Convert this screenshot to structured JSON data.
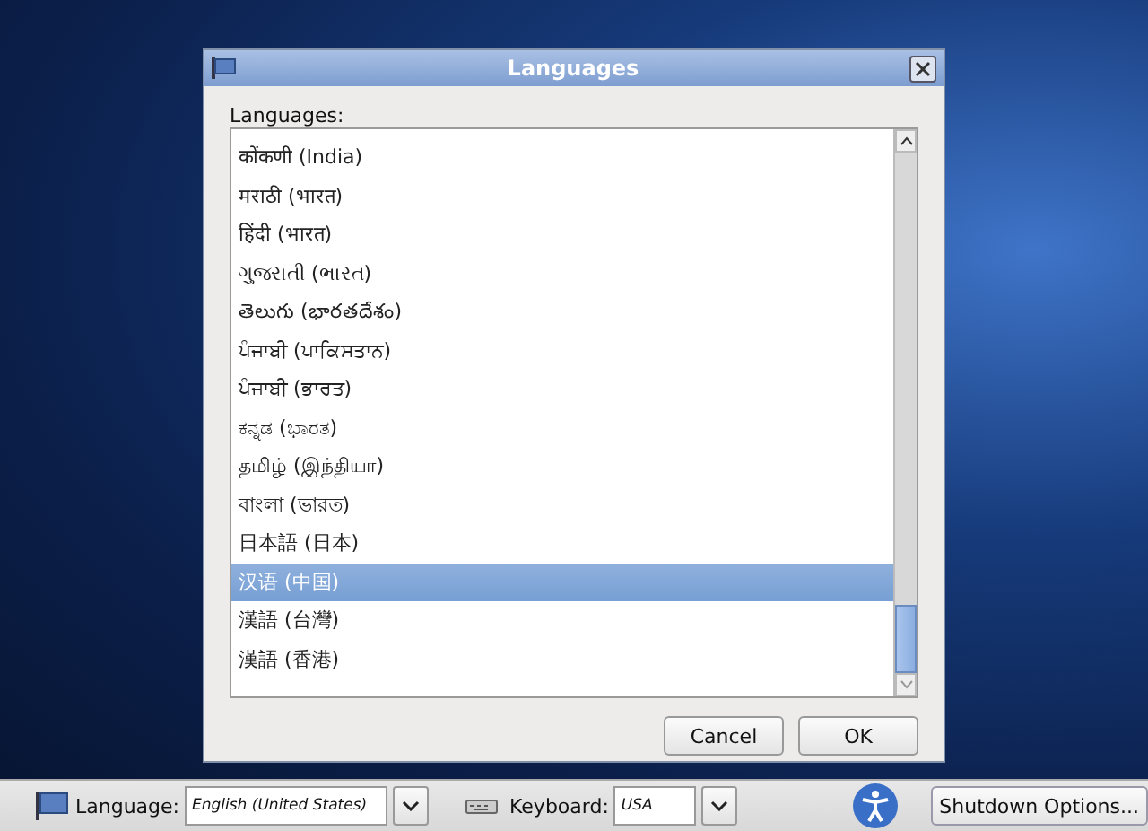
{
  "dialog": {
    "title": "Languages",
    "list_label": "Languages:",
    "items": [
      {
        "label": "कोंकणी (India)",
        "selected": false
      },
      {
        "label": "मराठी (भारत)",
        "selected": false
      },
      {
        "label": "हिंदी (भारत)",
        "selected": false
      },
      {
        "label": "ગુજરાતી (ભારત)",
        "selected": false
      },
      {
        "label": "తెలుగు (భారతదేశం)",
        "selected": false
      },
      {
        "label": "ਪੰਜਾਬੀ (ਪਾਕਿਸਤਾਨ)",
        "selected": false
      },
      {
        "label": "ਪੰਜਾਬੀ (ਭਾਰਤ)",
        "selected": false
      },
      {
        "label": "ಕನ್ನಡ (ಭಾರತ)",
        "selected": false
      },
      {
        "label": "தமிழ் (இந்தியா)",
        "selected": false
      },
      {
        "label": "বাংলা (ভারত)",
        "selected": false
      },
      {
        "label": "日本語 (日本)",
        "selected": false
      },
      {
        "label": "汉语 (中国)",
        "selected": true
      },
      {
        "label": "漢語 (台灣)",
        "selected": false
      },
      {
        "label": "漢語 (香港)",
        "selected": false
      }
    ],
    "buttons": [
      "Cancel",
      "OK"
    ]
  },
  "bottom_bar": {
    "language_label": "Language:",
    "language_value": "English (United States)",
    "keyboard_label": "Keyboard:",
    "keyboard_value": "USA",
    "shutdown_button": "Shutdown Options..."
  }
}
